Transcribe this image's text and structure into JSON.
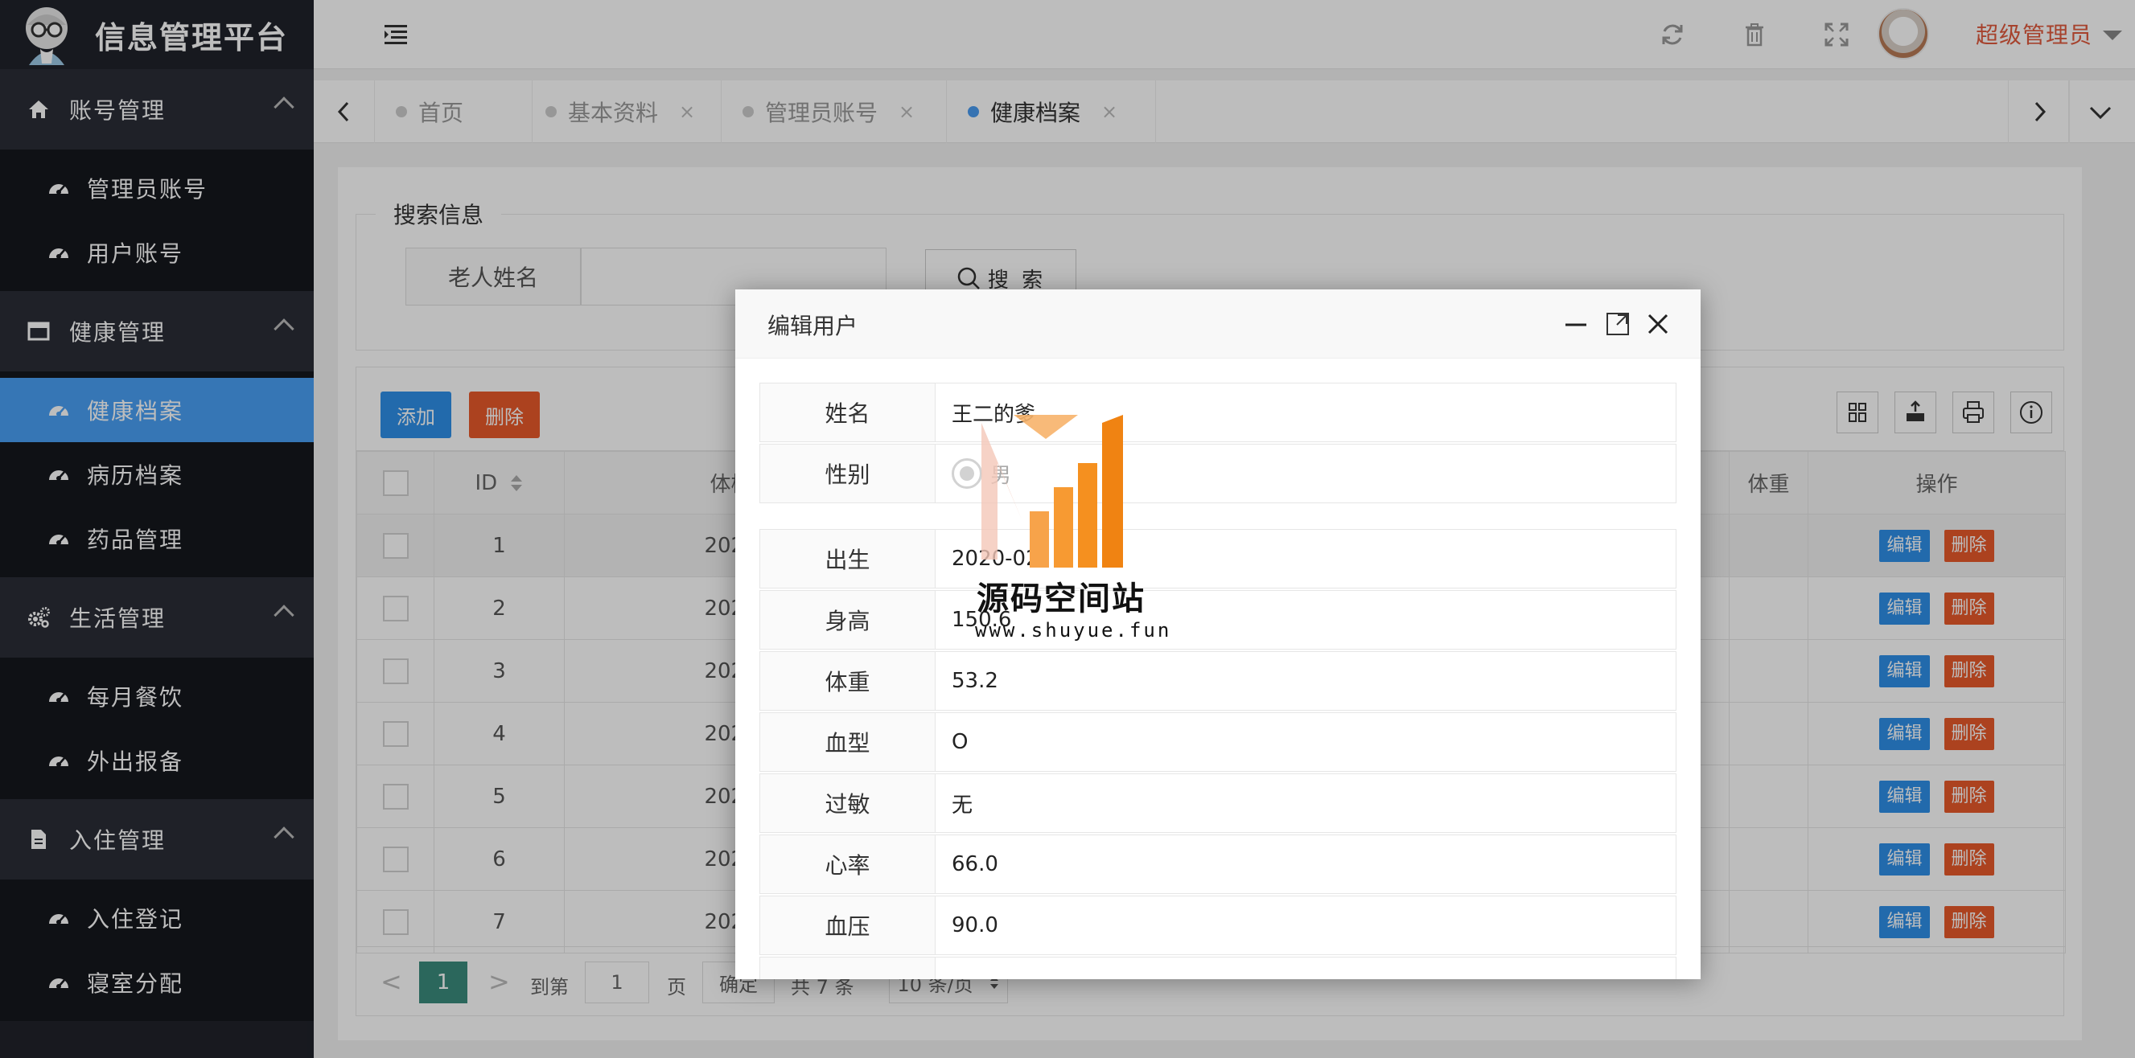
{
  "brand": {
    "title": "信息管理平台"
  },
  "sidebar": {
    "groups": [
      {
        "label": "账号管理",
        "items": [
          {
            "label": "管理员账号"
          },
          {
            "label": "用户账号"
          }
        ]
      },
      {
        "label": "健康管理",
        "items": [
          {
            "label": "健康档案",
            "active": true
          },
          {
            "label": "病历档案"
          },
          {
            "label": "药品管理"
          }
        ]
      },
      {
        "label": "生活管理",
        "items": [
          {
            "label": "每月餐饮"
          },
          {
            "label": "外出报备"
          }
        ]
      },
      {
        "label": "入住管理",
        "items": [
          {
            "label": "入住登记"
          },
          {
            "label": "寝室分配"
          }
        ]
      }
    ]
  },
  "header": {
    "user_name": "超级管理员"
  },
  "tabs": [
    {
      "label": "首页",
      "closable": false,
      "active": false
    },
    {
      "label": "基本资料",
      "closable": true,
      "active": false
    },
    {
      "label": "管理员账号",
      "closable": true,
      "active": false
    },
    {
      "label": "健康档案",
      "closable": true,
      "active": true
    }
  ],
  "tab_close_glyph": "×",
  "search": {
    "legend": "搜索信息",
    "field_label": "老人姓名",
    "field_value": "",
    "button_label": "搜 索"
  },
  "toolbar": {
    "add_label": "添加",
    "delete_label": "删除"
  },
  "table": {
    "columns": {
      "id": "ID",
      "exam_time": "体检时",
      "weight": "体重",
      "actions": "操作"
    },
    "rows": [
      {
        "id": "1",
        "exam_time": "2021-0"
      },
      {
        "id": "2",
        "exam_time": "2021-0"
      },
      {
        "id": "3",
        "exam_time": "2021-0"
      },
      {
        "id": "4",
        "exam_time": "2021-0"
      },
      {
        "id": "5",
        "exam_time": "2021-0"
      },
      {
        "id": "6",
        "exam_time": "2021-0"
      },
      {
        "id": "7",
        "exam_time": "2021-0"
      }
    ],
    "row_edit_label": "编辑",
    "row_delete_label": "删除"
  },
  "pager": {
    "prev": "<",
    "next": ">",
    "current_page": "1",
    "goto_prefix": "到第",
    "goto_value": "1",
    "goto_suffix": "页",
    "confirm_label": "确定",
    "total_text": "共 7 条",
    "page_size": "10 条/页"
  },
  "modal": {
    "title": "编辑用户",
    "fields_top": [
      {
        "label": "姓名",
        "value": "王二的爹"
      },
      {
        "label": "性别",
        "value": "男",
        "type": "radio"
      }
    ],
    "fields": [
      {
        "label": "出生",
        "value": "2020-02"
      },
      {
        "label": "身高",
        "value": "150.6"
      },
      {
        "label": "体重",
        "value": "53.2"
      },
      {
        "label": "血型",
        "value": "O"
      },
      {
        "label": "过敏",
        "value": "无"
      },
      {
        "label": "心率",
        "value": "66.0"
      },
      {
        "label": "血压",
        "value": "90.0"
      }
    ]
  },
  "watermark": {
    "title": "源码空间站",
    "url": "www.shuyue.fun"
  },
  "colors": {
    "sidebar_bg": "#20222a",
    "sidebar_active": "#4aa0f5",
    "primary_button": "#2f8fe8",
    "danger_button": "#e95a2b",
    "pager_current": "#3a8b7c",
    "user_name": "#e05a3d"
  },
  "icons": {
    "group_icons": [
      "home-icon",
      "window-icon",
      "gears-icon",
      "file-icon"
    ],
    "nav_item_icon": "dashboard-icon",
    "header": [
      "menu-toggle-icon",
      "refresh-icon",
      "trash-icon",
      "fullscreen-icon"
    ],
    "toolbar": [
      "columns-icon",
      "export-icon",
      "print-icon",
      "info-icon"
    ],
    "modal": [
      "minimize-icon",
      "maximize-icon",
      "close-icon"
    ]
  }
}
